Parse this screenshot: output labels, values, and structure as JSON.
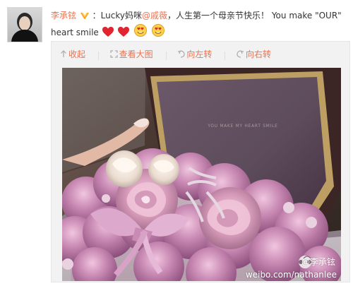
{
  "user": {
    "name": "李承铉"
  },
  "post": {
    "text_1": "：Lucky妈咪",
    "mention": "@戚薇",
    "text_2": "，人生第一个母亲节快乐！ You make \"OUR\"",
    "text_3": "heart smile"
  },
  "toolbar": {
    "collapse_label": "收起",
    "large_label": "查看大图",
    "rotate_left_label": "向左转",
    "rotate_right_label": "向右转"
  },
  "photo": {
    "inscription": "YOU MAKE MY HEART SMILE",
    "watermark_name": "@李承铉",
    "watermark_url": "weibo.com/nathanlee"
  },
  "colors": {
    "accent": "#eb7350",
    "heart": "#e1242f"
  }
}
